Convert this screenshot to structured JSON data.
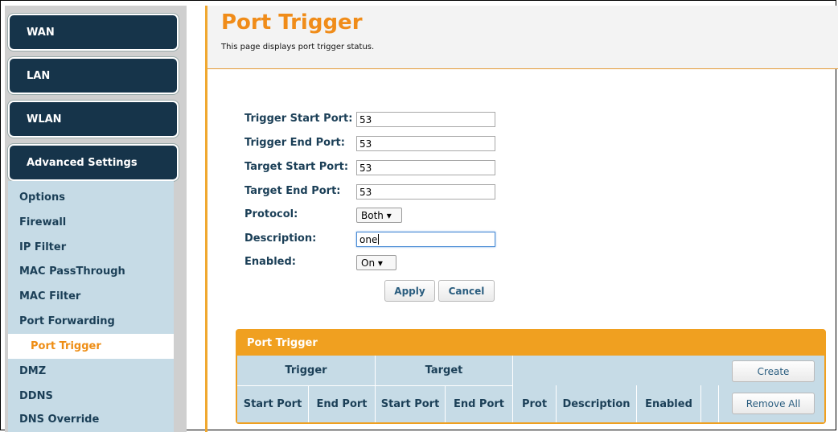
{
  "sidebar": {
    "main_items": [
      {
        "label": "WAN"
      },
      {
        "label": "LAN"
      },
      {
        "label": "WLAN"
      },
      {
        "label": "Advanced Settings"
      }
    ],
    "sub_items": [
      {
        "label": "Options"
      },
      {
        "label": "Firewall"
      },
      {
        "label": "IP Filter"
      },
      {
        "label": "MAC PassThrough"
      },
      {
        "label": "MAC Filter"
      },
      {
        "label": "Port Forwarding"
      },
      {
        "label": "Port Trigger",
        "active": true
      },
      {
        "label": "DMZ"
      },
      {
        "label": "DDNS"
      },
      {
        "label": "DNS Override"
      }
    ]
  },
  "page": {
    "title": "Port Trigger",
    "subtitle": "This page displays port trigger status."
  },
  "form": {
    "trigger_start_label": "Trigger Start Port:",
    "trigger_start_value": "53",
    "trigger_end_label": "Trigger End Port:",
    "trigger_end_value": "53",
    "target_start_label": "Target Start Port:",
    "target_start_value": "53",
    "target_end_label": "Target End Port:",
    "target_end_value": "53",
    "protocol_label": "Protocol:",
    "protocol_value": "Both ▾",
    "description_label": "Description:",
    "description_value": "one",
    "enabled_label": "Enabled:",
    "enabled_value": "On ▾",
    "apply_label": "Apply",
    "cancel_label": "Cancel"
  },
  "table": {
    "title": "Port Trigger",
    "group_trigger": "Trigger",
    "group_target": "Target",
    "columns": [
      "Start Port",
      "End Port",
      "Start Port",
      "End Port",
      "Prot",
      "Description",
      "Enabled"
    ],
    "create_label": "Create",
    "remove_all_label": "Remove All"
  },
  "colors": {
    "accent": "#f08c19",
    "nav_dark": "#16344a",
    "submenu_bg": "#c6dbe6",
    "text_blue": "#1b3f57"
  }
}
